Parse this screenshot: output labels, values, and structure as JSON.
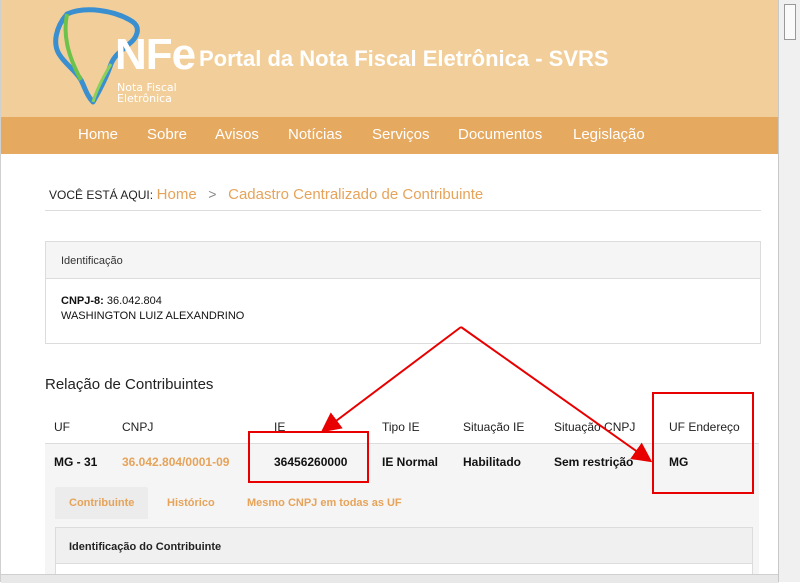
{
  "header": {
    "logo_main": "NFe",
    "logo_sub_line1": "Nota Fiscal",
    "logo_sub_line2": "Eletrônica",
    "site_title": "Portal da Nota Fiscal Eletrônica - SVRS"
  },
  "nav": {
    "items": [
      "Home",
      "Sobre",
      "Avisos",
      "Notícias",
      "Serviços",
      "Documentos",
      "Legislação"
    ]
  },
  "breadcrumb": {
    "label": "VOCÊ ESTÁ AQUI:",
    "home": "Home",
    "separator": ">",
    "current": "Cadastro Centralizado de Contribuinte"
  },
  "identificacao": {
    "title": "Identificação",
    "cnpj_label": "CNPJ-8:",
    "cnpj_value": "36.042.804",
    "name": "WASHINGTON LUIZ ALEXANDRINO"
  },
  "relacao": {
    "title": "Relação de Contribuintes",
    "columns": [
      "UF",
      "CNPJ",
      "IE",
      "Tipo IE",
      "Situação IE",
      "Situação CNPJ",
      "UF Endereço"
    ],
    "row": [
      "MG - 31",
      "36.042.804/0001-09",
      "36456260000",
      "IE Normal",
      "Habilitado",
      "Sem restrição",
      "MG"
    ]
  },
  "tabs": [
    "Contribuinte",
    "Histórico",
    "Mesmo CNPJ em todas as UF"
  ],
  "subpanel": {
    "title": "Identificação do Contribuinte"
  },
  "colors": {
    "header_bg": "#f2cf9a",
    "nav_bg": "#e6a960",
    "accent": "#e6a35a",
    "annotation_red": "#e80000"
  }
}
